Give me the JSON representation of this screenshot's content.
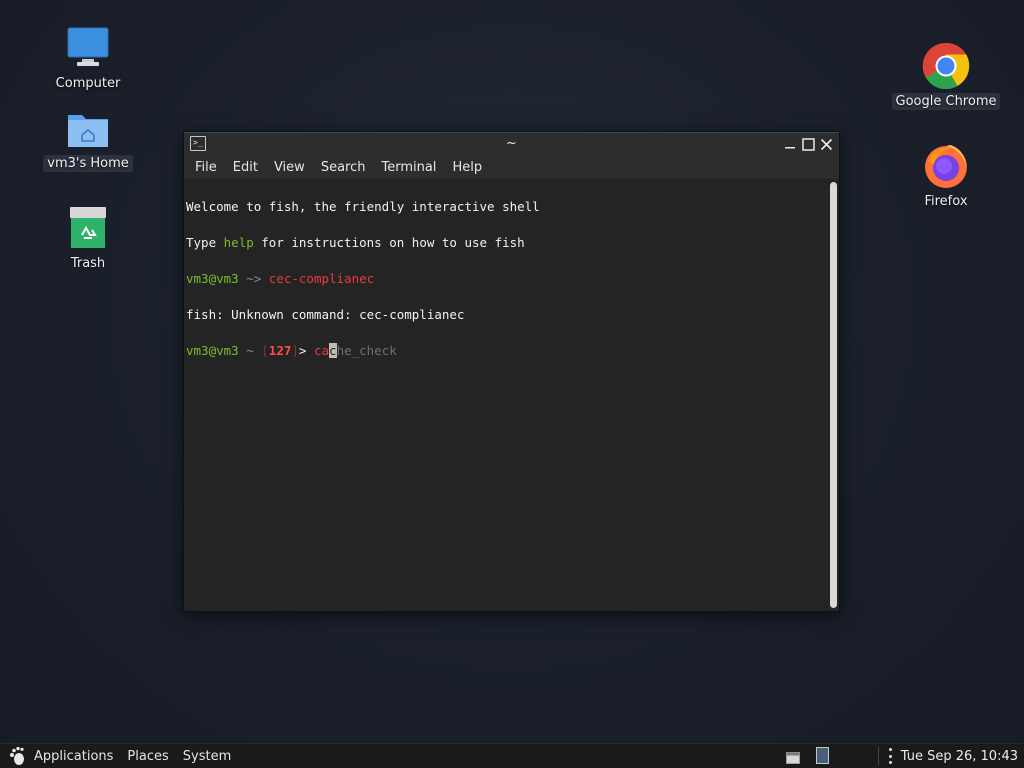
{
  "desktop": {
    "icons_left": [
      {
        "label": "Computer",
        "icon": "computer-icon"
      },
      {
        "label": "vm3's Home",
        "icon": "home-folder-icon"
      },
      {
        "label": "Trash",
        "icon": "trash-icon"
      }
    ],
    "icons_right": [
      {
        "label": "Google Chrome",
        "icon": "chrome-icon"
      },
      {
        "label": "Firefox",
        "icon": "firefox-icon"
      }
    ]
  },
  "terminal": {
    "title": "~",
    "menu": [
      "File",
      "Edit",
      "View",
      "Search",
      "Terminal",
      "Help"
    ],
    "lines": {
      "l1": "Welcome to fish, the friendly interactive shell",
      "l2_pre": "Type ",
      "l2_cmd": "help",
      "l2_post": " for instructions on how to use fish",
      "l3_user": "vm3@vm3",
      "l3_path": " ~> ",
      "l3_cmd": "cec-complianec",
      "l4": "fish: Unknown command: cec-complianec",
      "l5_user": "vm3@vm3",
      "l5_path": " ~ ",
      "l5_bracket_open": "[",
      "l5_status": "127",
      "l5_bracket_close": "]",
      "l5_arrow": "> ",
      "l5_typed": "ca",
      "l5_cursor_char": "c",
      "l5_suggestion": "he_check"
    }
  },
  "panel": {
    "applications": "Applications",
    "places": "Places",
    "system": "System",
    "clock": "Tue Sep 26, 10:43"
  },
  "colors": {
    "prompt_user": "#7bbd2a",
    "error_red": "#e83a3a",
    "background": "#1a1f2a"
  }
}
